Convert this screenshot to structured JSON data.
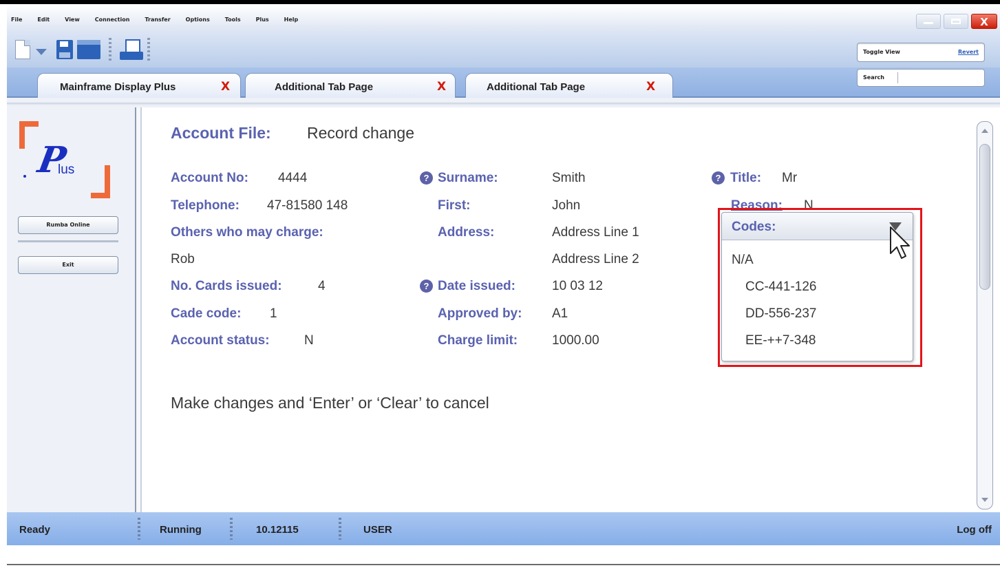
{
  "menu": [
    "File",
    "Edit",
    "View",
    "Connection",
    "Transfer",
    "Options",
    "Tools",
    "Plus",
    "Help"
  ],
  "toolbar": {
    "toggle_view": "Toggle View",
    "revert": "Revert",
    "search": "Search"
  },
  "tabs": [
    {
      "label": "Mainframe Display Plus",
      "close": "X"
    },
    {
      "label": "Additional Tab Page",
      "close": "X"
    },
    {
      "label": "Additional Tab Page",
      "close": "X"
    }
  ],
  "sidebar": {
    "logo_text": "lus",
    "logo_letter": "P",
    "buttons": [
      "Rumba Online",
      "Exit"
    ]
  },
  "form": {
    "title_label": "Account File:",
    "title_value": "Record change",
    "account_no": {
      "label": "Account No:",
      "value": "4444"
    },
    "telephone": {
      "label": "Telephone:",
      "value": "47-81580 148"
    },
    "others": {
      "label": "Others who may charge:",
      "value": "Rob"
    },
    "cards": {
      "label": "No. Cards issued:",
      "value": "4"
    },
    "cade": {
      "label": "Cade code:",
      "value": "1"
    },
    "status": {
      "label": "Account status:",
      "value": "N"
    },
    "surname": {
      "label": "Surname:",
      "value": "Smith"
    },
    "first": {
      "label": "First:",
      "value": "John"
    },
    "address": {
      "label": "Address:",
      "line1": "Address Line 1",
      "line2": "Address Line 2"
    },
    "date_issued": {
      "label": "Date issued:",
      "value": "10 03 12"
    },
    "approved": {
      "label": "Approved by:",
      "value": "A1"
    },
    "limit": {
      "label": "Charge limit:",
      "value": "1000.00"
    },
    "title": {
      "label": "Title:",
      "value": "Mr"
    },
    "reason": {
      "label": "Reason:",
      "value": "N"
    },
    "help_glyph": "?"
  },
  "codes": {
    "label": "Codes:",
    "options": [
      "N/A",
      "CC-441-126",
      "DD-556-237",
      "EE-++7-348"
    ]
  },
  "message": "Make changes and ‘Enter’ or ‘Clear’ to cancel",
  "status_bar": {
    "ready": "Ready",
    "running": "Running",
    "version": "10.12115",
    "user": "USER",
    "logoff": "Log off"
  },
  "colors": {
    "label_purple": "#5a62b0",
    "highlight_red": "#e2141a",
    "tab_close_red": "#d41a0a",
    "status_blue": "#94b8ec"
  }
}
